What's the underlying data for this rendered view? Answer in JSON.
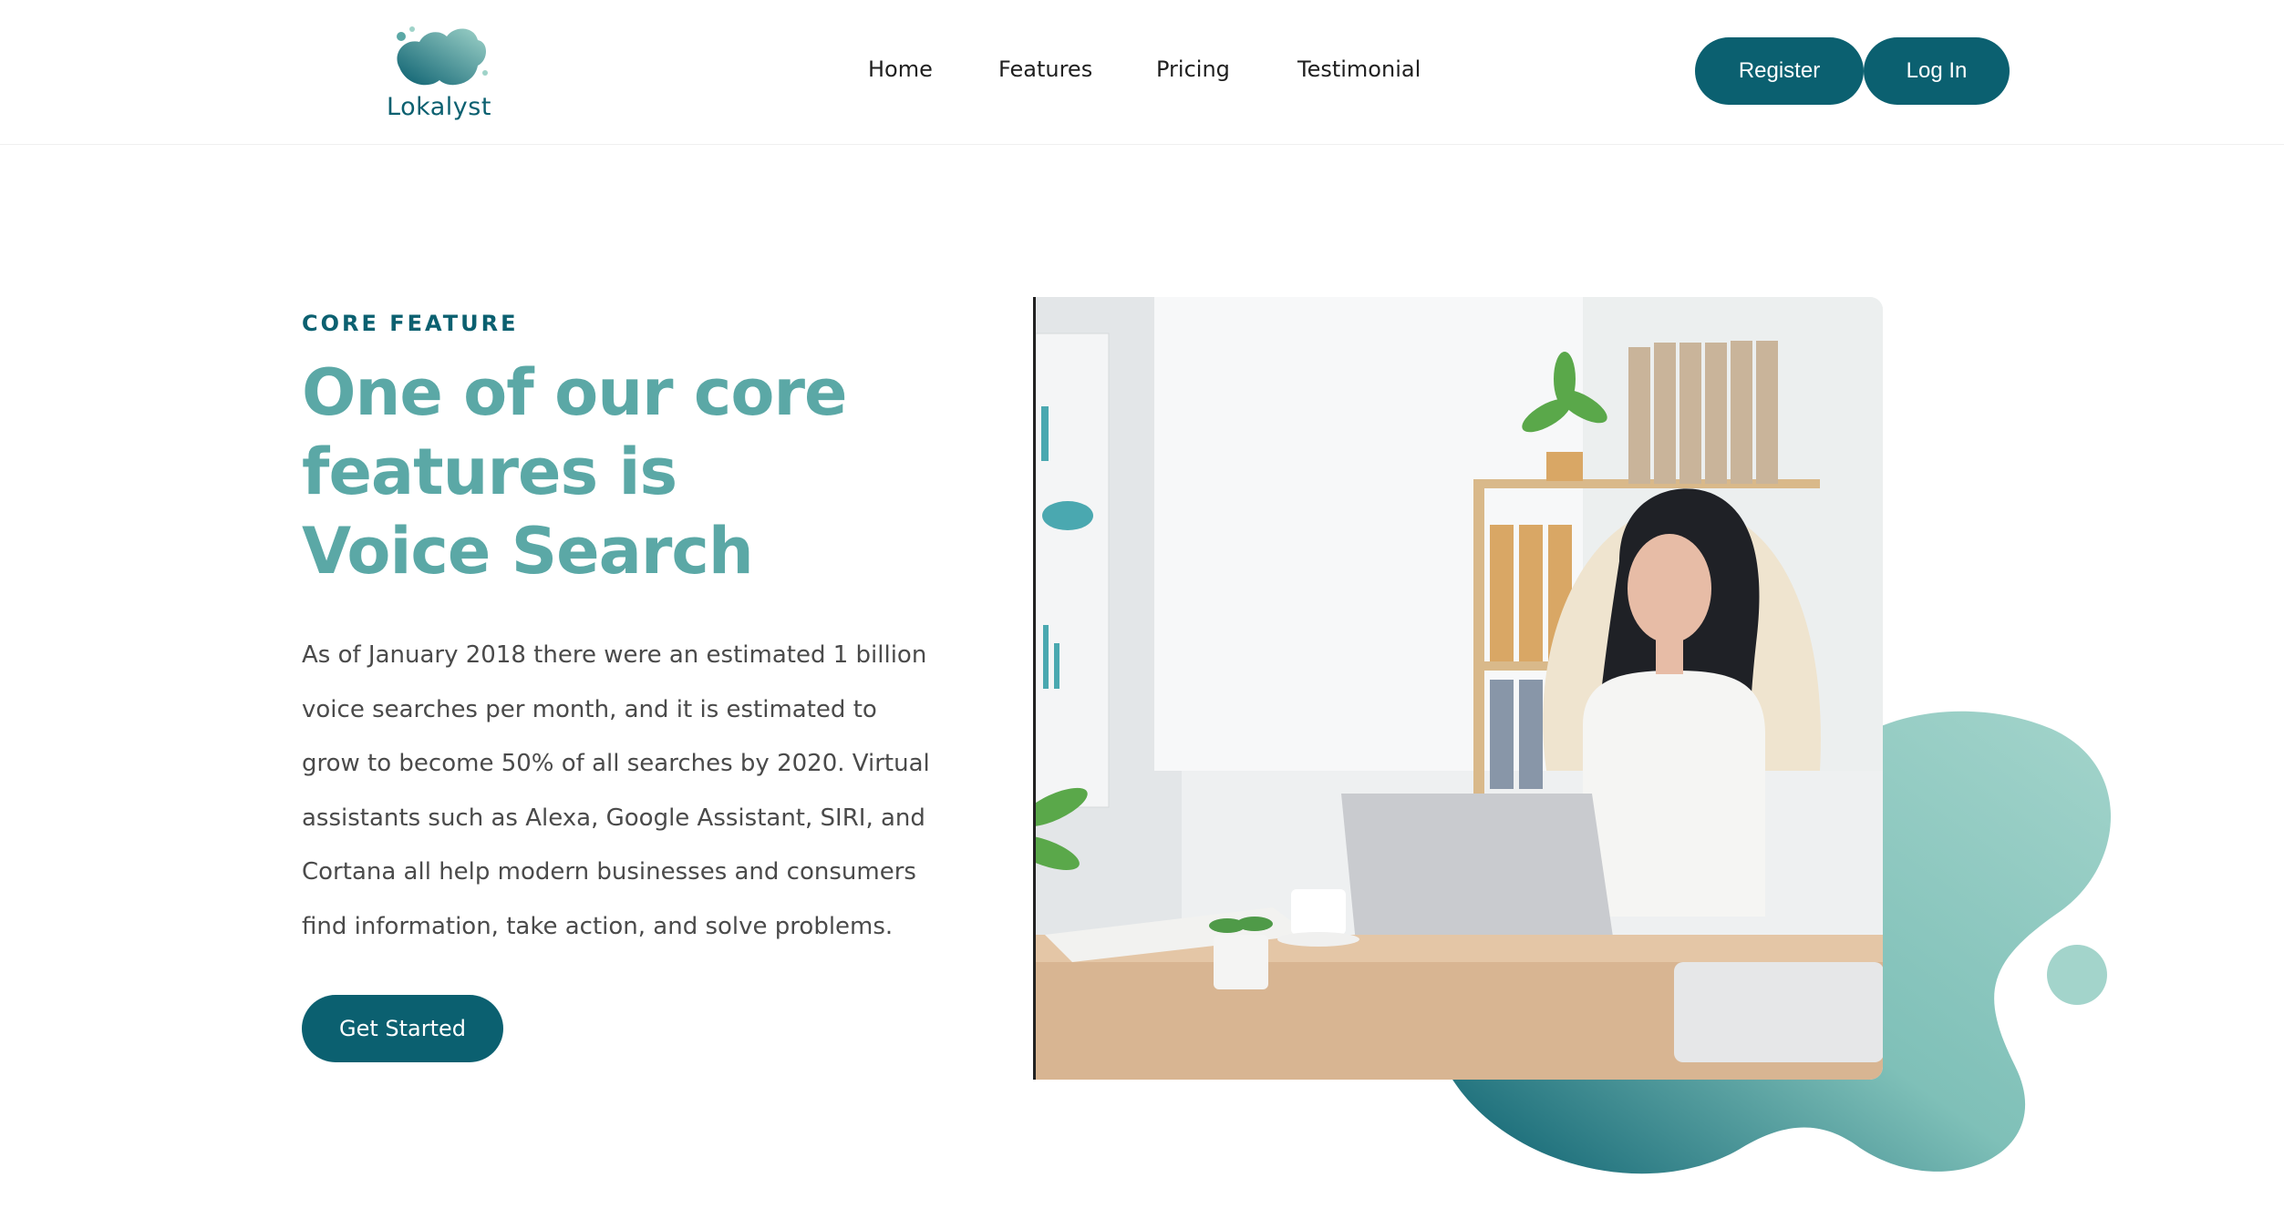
{
  "header": {
    "logo": {
      "text": "Lokalyst",
      "icon": "cloud-blob-logo-icon"
    },
    "nav": [
      "Home",
      "Features",
      "Pricing",
      "Testimonial"
    ],
    "register_label": "Register",
    "login_label": "Log In"
  },
  "hero": {
    "eyebrow": "CORE FEATURE",
    "title": "One of our core features is Voice Search",
    "body": "As of January 2018 there were an estimated 1 billion voice searches per month, and it is estimated to grow to become 50% of all searches by 2020. Virtual assistants such as Alexa, Google Assistant, SIRI, and Cortana all help modern businesses and consumers find information, take action, and solve problems.",
    "cta_label": "Get Started",
    "image": "woman-at-laptop-office-photo"
  },
  "colors": {
    "primary": "#0b6070",
    "accent": "#5ba8a6",
    "blob_light": "#9fd3c9",
    "text": "#4a4a4a"
  }
}
